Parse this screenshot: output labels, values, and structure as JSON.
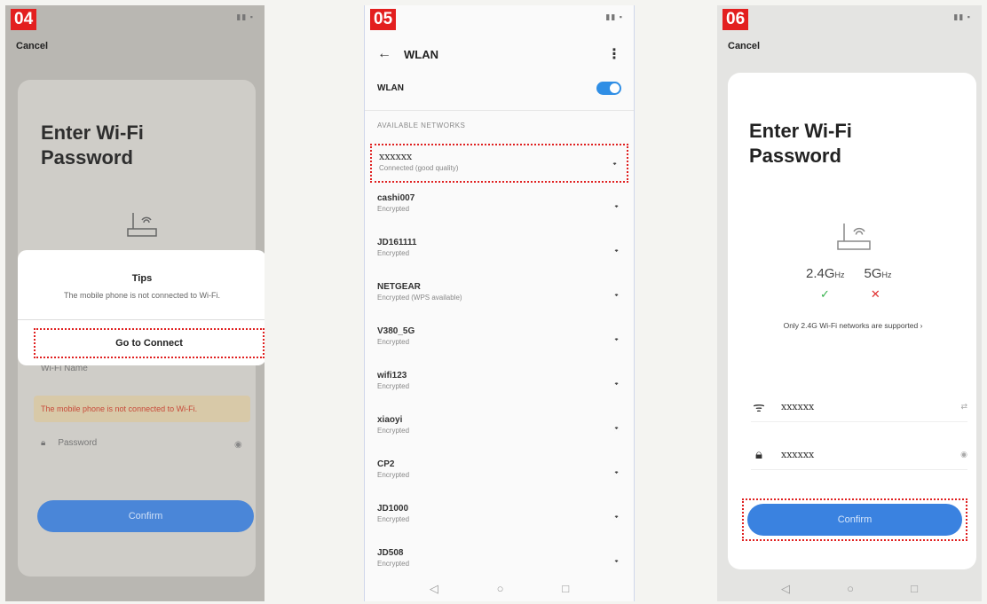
{
  "steps": {
    "p4": "04",
    "p5": "05",
    "p6": "06"
  },
  "p4": {
    "cancel": "Cancel",
    "title": "Enter Wi-Fi Password",
    "dialog": {
      "title": "Tips",
      "message": "The mobile phone is not connected to Wi-Fi.",
      "button": "Go to Connect"
    },
    "name_placeholder": "Wi-Fi Name",
    "warning": "The mobile phone is not connected to Wi-Fi.",
    "password_placeholder": "Password",
    "confirm": "Confirm"
  },
  "p5": {
    "title": "WLAN",
    "wlan_label": "WLAN",
    "wlan_on": true,
    "section": "AVAILABLE NETWORKS",
    "networks": [
      {
        "name": "xxxxxx",
        "status": "Connected (good quality)"
      },
      {
        "name": "cashi007",
        "status": "Encrypted"
      },
      {
        "name": "JD161111",
        "status": "Encrypted"
      },
      {
        "name": "NETGEAR",
        "status": "Encrypted (WPS available)"
      },
      {
        "name": "V380_5G",
        "status": "Encrypted"
      },
      {
        "name": "wifi123",
        "status": "Encrypted"
      },
      {
        "name": "xiaoyi",
        "status": "Encrypted"
      },
      {
        "name": "CP2",
        "status": "Encrypted"
      },
      {
        "name": "JD1000",
        "status": "Encrypted"
      },
      {
        "name": "JD508",
        "status": "Encrypted"
      }
    ],
    "icons": {
      "back": "back-arrow-icon",
      "more": "more-vertical-icon",
      "wifi": "wifi-signal-icon"
    }
  },
  "p6": {
    "cancel": "Cancel",
    "title": "Enter Wi-Fi Password",
    "band_24": "2.4G",
    "band_24_unit": "Hz",
    "band_5": "5G",
    "band_5_unit": "Hz",
    "check": "✓",
    "cross": "✕",
    "note": "Only 2.4G Wi-Fi networks are supported",
    "wifi_name": "xxxxxx",
    "password": "xxxxxx",
    "confirm": "Confirm"
  },
  "colors": {
    "step_badge": "#e31f1f",
    "accent": "#3a82e0",
    "highlight": "#e02020"
  }
}
